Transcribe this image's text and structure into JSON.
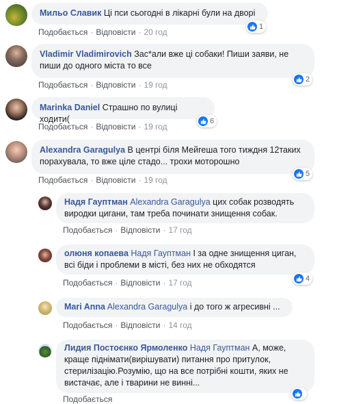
{
  "actions": {
    "like": "Подобається",
    "reply": "Відповісти",
    "sep": "·"
  },
  "comments": [
    {
      "author": "Мильо Славик",
      "mention": "",
      "text": "Ці пси сьогодні в лікарні були на дворі",
      "time": "20 год",
      "likes": "1"
    },
    {
      "author": "Vladimir Vladimirovich",
      "mention": "",
      "text": "Зас*али вже ці собаки! Пиши заяви, не пиши до одного міста то все",
      "time": "19 год",
      "likes": "2"
    },
    {
      "author": "Marinka Daniel",
      "mention": "",
      "text": "Страшно по вулиці ходити(",
      "time": "19 год",
      "likes": "6"
    },
    {
      "author": "Alexandra Garagulya",
      "mention": "",
      "text": "В центрі біля Мейгеша того тиждня 12таких порахувала, то вже ціле стадо... трохи моторошно",
      "time": "19 год",
      "likes": "5"
    }
  ],
  "replies": [
    {
      "author": "Надя Гауптман",
      "mention": "Alexandra Garagulya",
      "text": "цих собак розводять виродки цигани, там треба починати знищення собак.",
      "time": "17 год",
      "likes": ""
    },
    {
      "author": "олюня копаева",
      "mention": "Надя Гауптман",
      "text": "І за одне знищення циган, всі біди і проблеми в місті, без них не обходятся",
      "time": "17 год",
      "likes": "4"
    },
    {
      "author": "Mari Anna",
      "mention": "Alexandra Garagulya",
      "text": "і до того ж агресивні ...",
      "time": "14 год",
      "likes": ""
    },
    {
      "author": "Лидия Постоєнко Ярмоленко",
      "mention": "Надя Гауптман",
      "text": "А, може, краще піднімати(вирішувати) питання про притулок, стерилізацію.Розумію, що на все потрібні кошти, яких не вистачає, але і тварини не винні...",
      "time": "",
      "likes": ""
    }
  ],
  "colors": {
    "link": "#385898",
    "bubble": "#f2f3f5",
    "like": "#1877f2"
  }
}
